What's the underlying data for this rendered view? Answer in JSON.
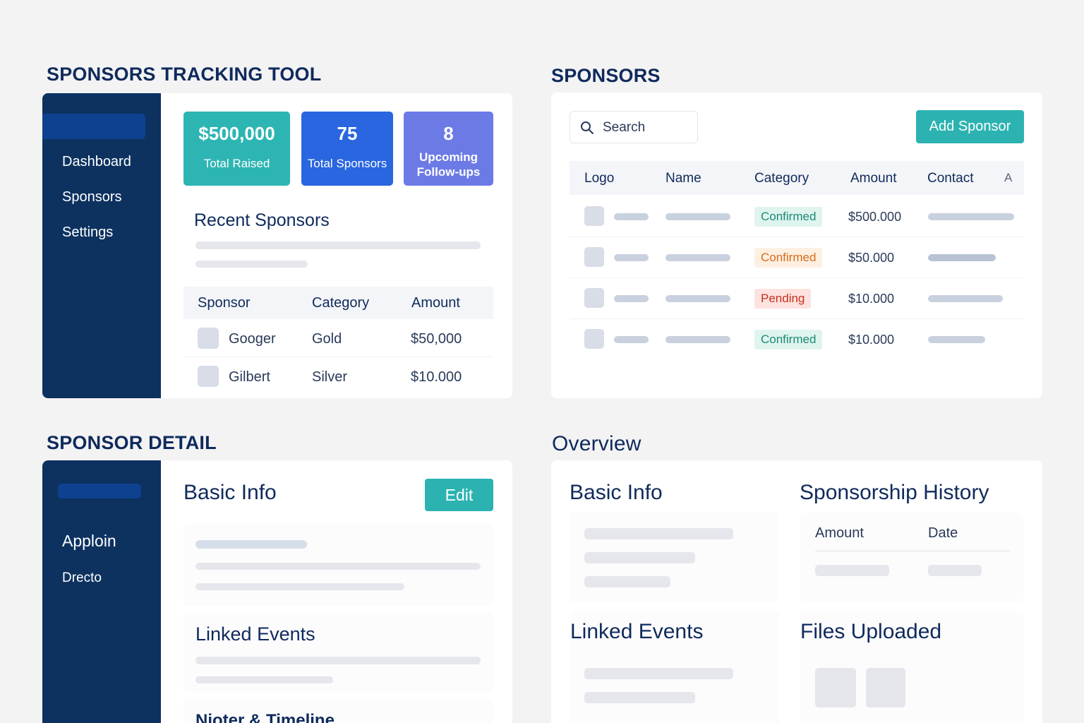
{
  "tracking": {
    "title": "SPONSORS TRACKING TOOL",
    "nav": [
      "Dashboard",
      "Sponsors",
      "Settings"
    ],
    "stats": [
      {
        "value": "$500,000",
        "label": "Total Raised",
        "color": "#2db5b3"
      },
      {
        "value": "75",
        "label": "Total Sponsors",
        "color": "#2966e0"
      },
      {
        "value": "8",
        "label": "Upcoming Follow-ups",
        "label_lines": [
          "Upcoming",
          "Follow-ups"
        ],
        "color": "#6c7ae6"
      }
    ],
    "recent_title": "Recent Sponsors",
    "table_headers": [
      "Sponsor",
      "Category",
      "Amount"
    ],
    "rows": [
      {
        "sponsor": "Googer",
        "category": "Gold",
        "amount": "$50,000"
      },
      {
        "sponsor": "Gilbert",
        "category": "Silver",
        "amount": "$10.000"
      }
    ]
  },
  "sponsors": {
    "title": "SPONSORS",
    "search_placeholder": "Search",
    "add_button": "Add Sponsor",
    "headers": [
      "Logo",
      "Name",
      "Category",
      "Amount",
      "Contact",
      "A"
    ],
    "rows": [
      {
        "category": "Confirmed",
        "status": "confirmed",
        "amount": "$500.000"
      },
      {
        "category": "Confirmed",
        "status": "warning",
        "amount": "$50.000"
      },
      {
        "category": "Pending",
        "status": "pending",
        "amount": "$10.000"
      },
      {
        "category": "Confirmed",
        "status": "confirmed",
        "amount": "$10.000"
      }
    ]
  },
  "detail": {
    "title": "SPONSOR DETAIL",
    "nav": [
      "Applоin",
      "Drecto"
    ],
    "basic_info": "Basic Info",
    "edit_button": "Edit",
    "linked_events": "Linked Events",
    "notes": "Nioter & Timeline"
  },
  "overview": {
    "title": "Overview",
    "basic_info": "Basic Info",
    "history_title": "Sponsorship History",
    "history_headers": [
      "Amount",
      "Date"
    ],
    "linked_events": "Linked Events",
    "files_title": "Files Uploaded"
  },
  "colors": {
    "navy": "#0d3260",
    "teal": "#2cb3b1",
    "blue": "#2966e0",
    "violet": "#6c7ae6",
    "heading": "#0f2a5c"
  }
}
